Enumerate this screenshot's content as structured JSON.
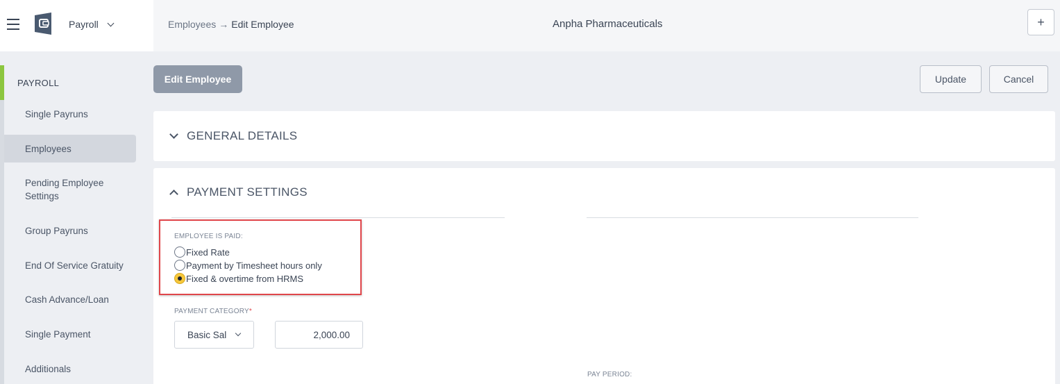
{
  "header": {
    "module": "Payroll",
    "breadcrumb": {
      "parent": "Employees",
      "separator": "→",
      "current": "Edit Employee"
    },
    "company": "Anpha Pharmaceuticals",
    "add_button": "+"
  },
  "sidebar": {
    "heading": "PAYROLL",
    "items": [
      {
        "label": "Single Payruns"
      },
      {
        "label": "Employees",
        "active": true
      },
      {
        "label": "Pending Employee Settings"
      },
      {
        "label": "Group Payruns"
      },
      {
        "label": "End Of Service Gratuity"
      },
      {
        "label": "Cash Advance/Loan"
      },
      {
        "label": "Single Payment"
      },
      {
        "label": "Additionals"
      }
    ]
  },
  "main": {
    "page_tag": "Edit Employee",
    "update_label": "Update",
    "cancel_label": "Cancel",
    "sections": {
      "general": "GENERAL DETAILS",
      "payment": "PAYMENT SETTINGS"
    },
    "employee_is_paid": {
      "label": "EMPLOYEE IS PAID:",
      "options": [
        {
          "label": "Fixed Rate",
          "selected": false
        },
        {
          "label": "Payment by Timesheet hours only",
          "selected": false
        },
        {
          "label": "Fixed & overtime from HRMS",
          "selected": true
        }
      ]
    },
    "payment_category": {
      "label": "PAYMENT CATEGORY",
      "required_mark": "*",
      "selected": "Basic Sal",
      "amount": "2,000.00"
    },
    "pay_period_label": "PAY PERIOD:"
  },
  "colors": {
    "accent_green": "#8cc63f",
    "highlight_red": "#e0464b",
    "radio_selected": "#f6c73b"
  }
}
